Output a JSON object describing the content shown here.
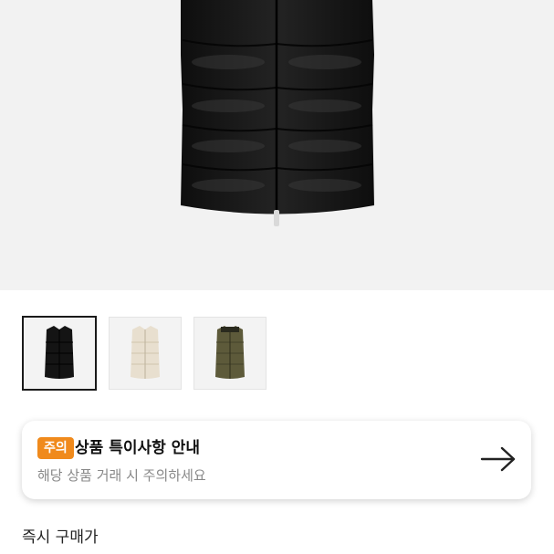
{
  "product": {
    "thumbnails": [
      {
        "color_name": "black",
        "color": "#141414",
        "selected": true
      },
      {
        "color_name": "cream",
        "color": "#e8dfcf",
        "selected": false
      },
      {
        "color_name": "khaki",
        "color": "#5d5a3a",
        "selected": false
      }
    ]
  },
  "notice": {
    "badge": "주의",
    "title": "상품 특이사항 안내",
    "subtitle": "해당 상품 거래 시 주의하세요"
  },
  "price_section": {
    "label": "즉시 구매가"
  },
  "colors": {
    "badge": "#f08a1c",
    "hero_bg": "#f2f2f2"
  }
}
